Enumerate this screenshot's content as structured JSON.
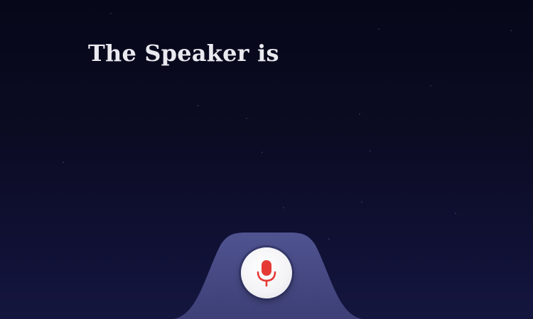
{
  "prompt": {
    "text": "The Speaker is"
  },
  "mic": {
    "icon": "microphone-icon",
    "icon_color": "#e53935",
    "button_color": "#f4f4f6"
  },
  "colors": {
    "background_top": "#07071a",
    "background_bottom": "#15163f",
    "dock": "#4a4d86",
    "text": "#e9e9ef"
  }
}
